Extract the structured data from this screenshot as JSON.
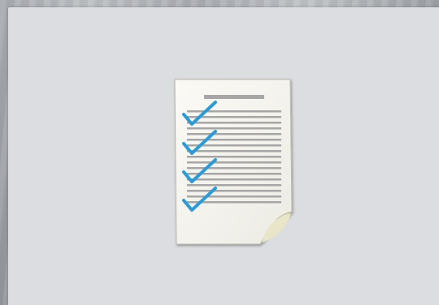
{
  "screen": {
    "description_icon": "checklist-document-icon",
    "colors": {
      "panel": "#dcdde0",
      "page": "#f5f4ee",
      "checkmark": "#2d9ad6",
      "text_lines": "#a6a6a6"
    }
  }
}
